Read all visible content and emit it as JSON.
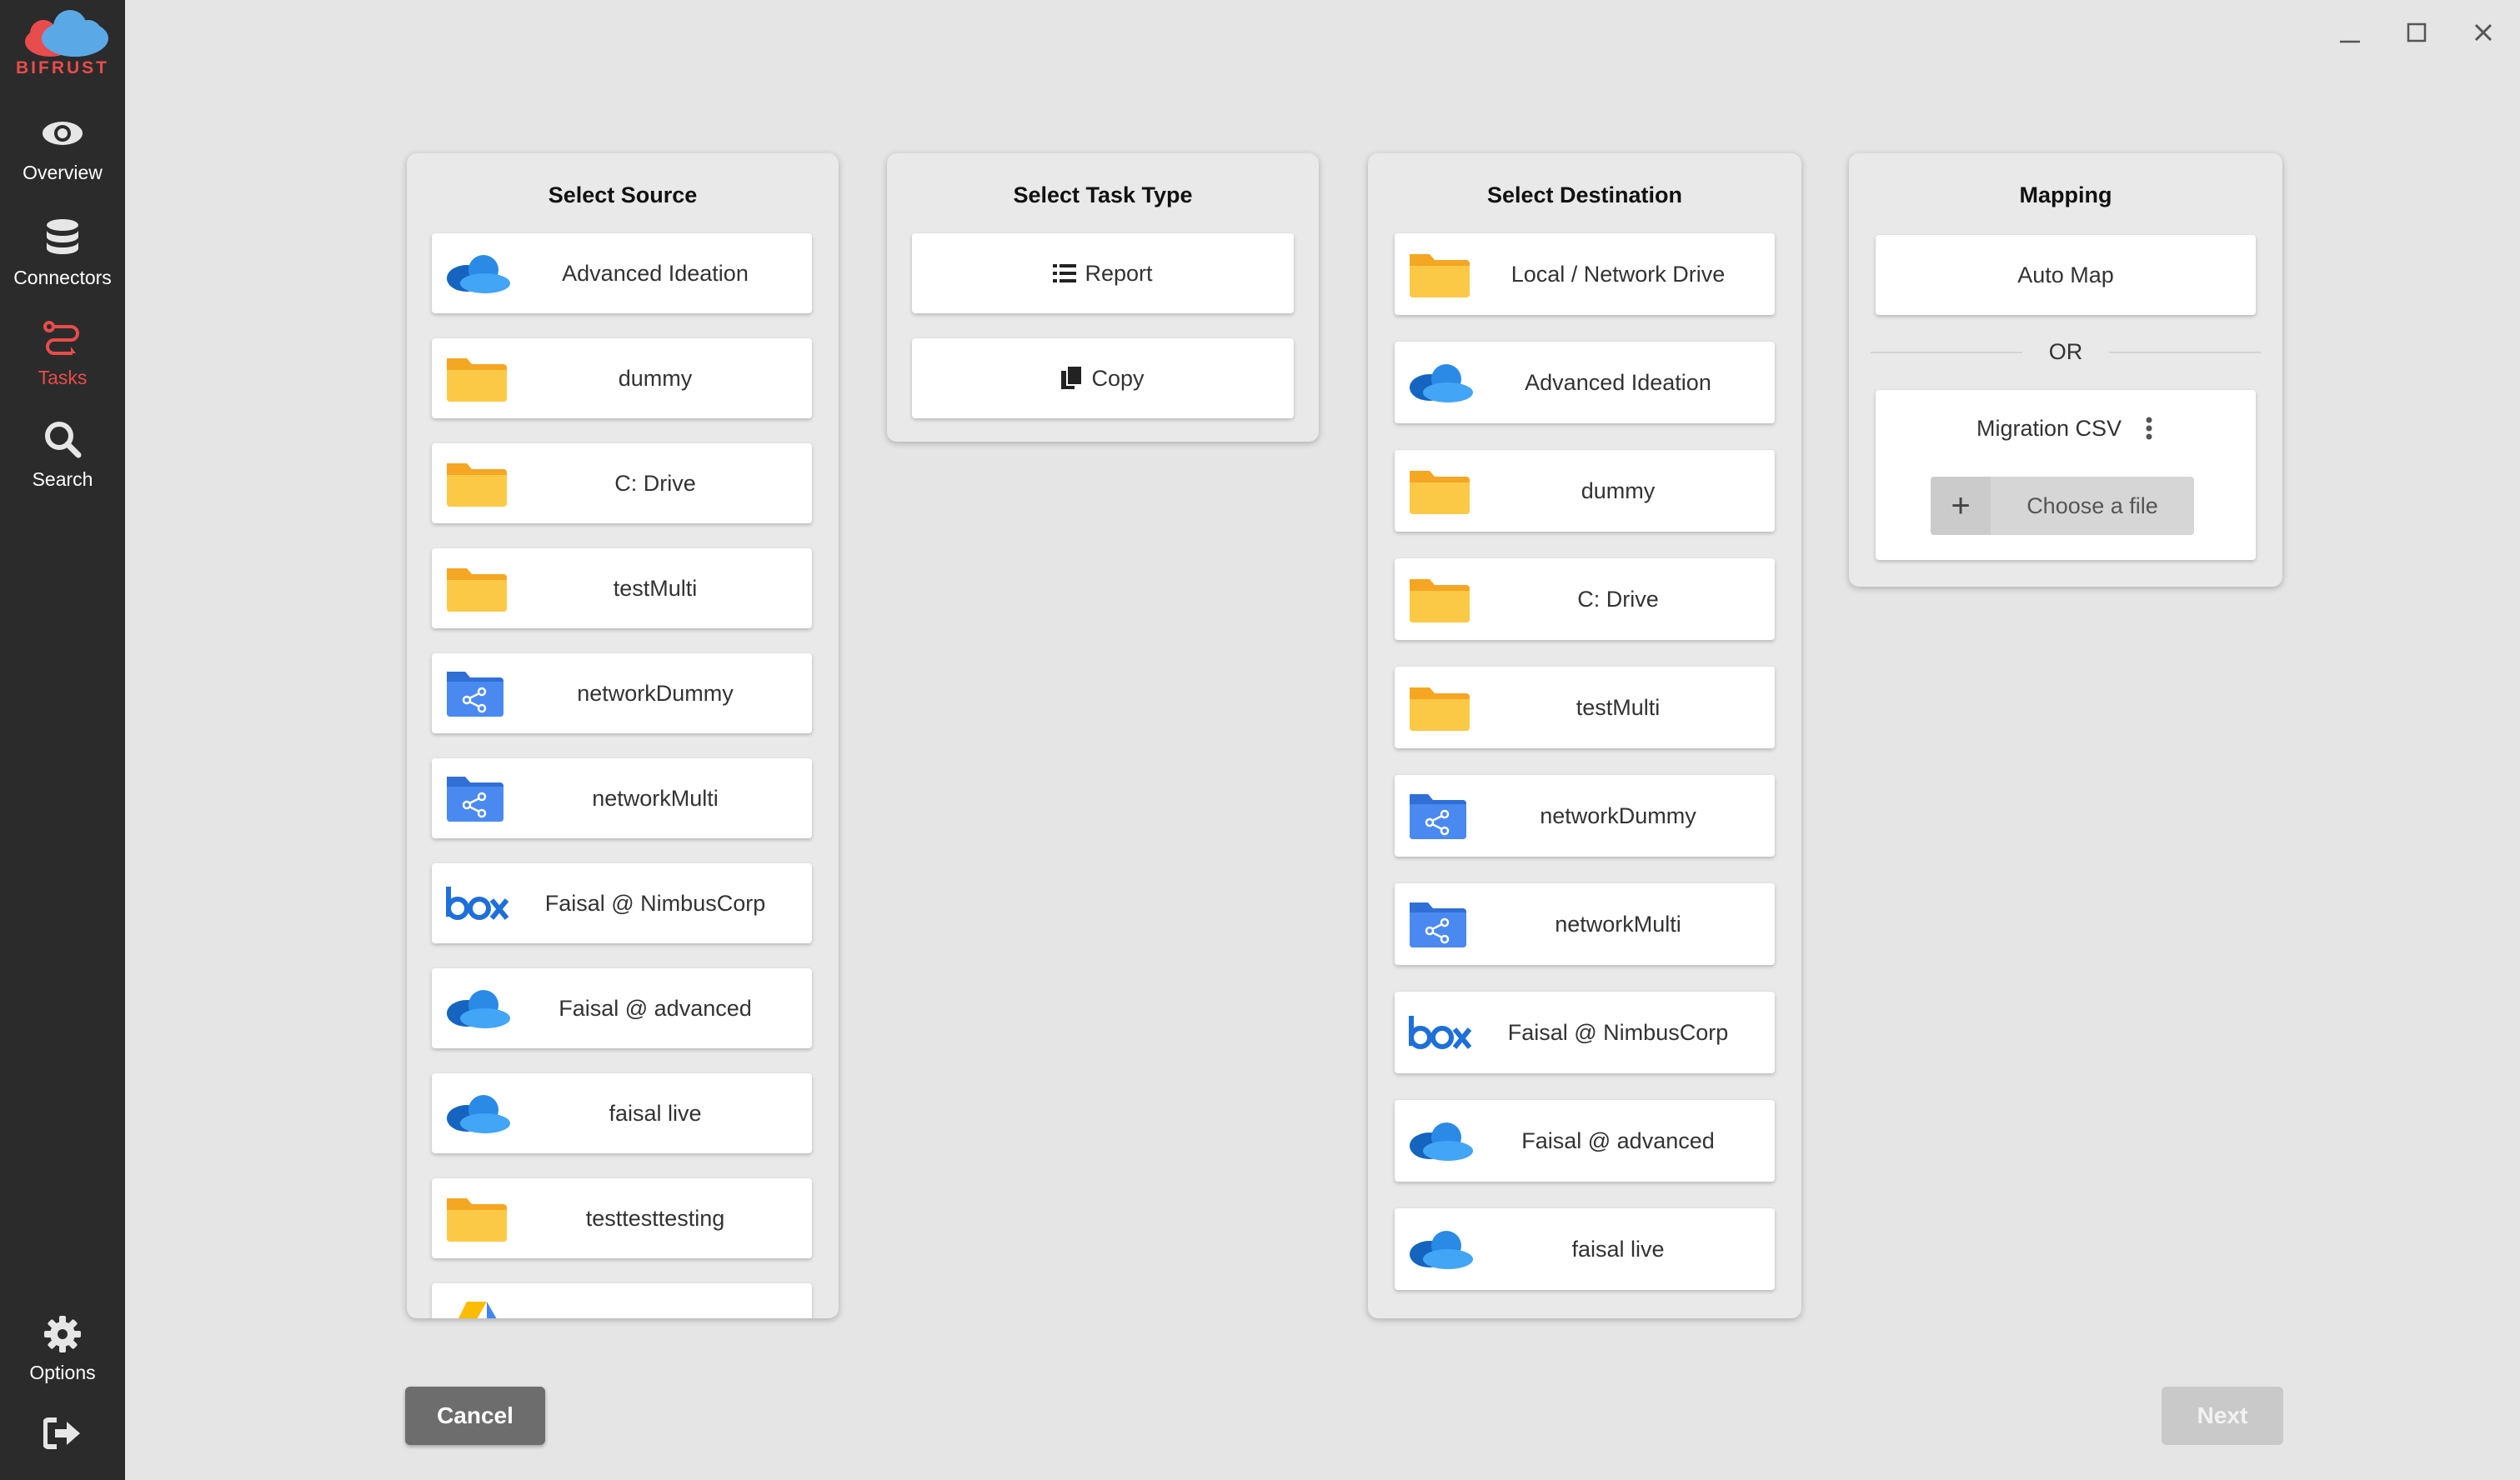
{
  "app": {
    "logo_text": "BIFRUST"
  },
  "sidebar": {
    "items": [
      {
        "label": "Overview",
        "icon": "eye-icon"
      },
      {
        "label": "Connectors",
        "icon": "database-icon"
      },
      {
        "label": "Tasks",
        "icon": "tasks-icon",
        "active": true
      },
      {
        "label": "Search",
        "icon": "search-icon"
      }
    ],
    "options_label": "Options",
    "logout_icon": "logout-icon"
  },
  "source": {
    "title": "Select Source",
    "items": [
      {
        "label": "Advanced Ideation",
        "icon": "onedrive-icon"
      },
      {
        "label": "dummy",
        "icon": "folder-icon"
      },
      {
        "label": "C: Drive",
        "icon": "folder-icon"
      },
      {
        "label": "testMulti",
        "icon": "folder-icon"
      },
      {
        "label": "networkDummy",
        "icon": "network-folder-icon"
      },
      {
        "label": "networkMulti",
        "icon": "network-folder-icon"
      },
      {
        "label": "Faisal @ NimbusCorp",
        "icon": "box-icon"
      },
      {
        "label": "Faisal @ advanced",
        "icon": "onedrive-icon"
      },
      {
        "label": "faisal live",
        "icon": "onedrive-icon"
      },
      {
        "label": "testtesttesting",
        "icon": "folder-icon"
      },
      {
        "label": "",
        "icon": "google-drive-icon"
      }
    ]
  },
  "task_type": {
    "title": "Select Task Type",
    "items": [
      {
        "label": "Report",
        "icon": "list-icon"
      },
      {
        "label": "Copy",
        "icon": "copy-icon"
      }
    ]
  },
  "destination": {
    "title": "Select Destination",
    "items": [
      {
        "label": "Local / Network Drive",
        "icon": "folder-icon"
      },
      {
        "label": "Advanced Ideation",
        "icon": "onedrive-icon"
      },
      {
        "label": "dummy",
        "icon": "folder-icon"
      },
      {
        "label": "C: Drive",
        "icon": "folder-icon"
      },
      {
        "label": "testMulti",
        "icon": "folder-icon"
      },
      {
        "label": "networkDummy",
        "icon": "network-folder-icon"
      },
      {
        "label": "networkMulti",
        "icon": "network-folder-icon"
      },
      {
        "label": "Faisal @ NimbusCorp",
        "icon": "box-icon"
      },
      {
        "label": "Faisal @ advanced",
        "icon": "onedrive-icon"
      },
      {
        "label": "faisal live",
        "icon": "onedrive-icon"
      }
    ]
  },
  "mapping": {
    "title": "Mapping",
    "auto_map_label": "Auto Map",
    "or_label": "OR",
    "csv_label": "Migration CSV",
    "choose_file_label": "Choose a file",
    "plus_label": "+"
  },
  "footer": {
    "cancel_label": "Cancel",
    "next_label": "Next"
  },
  "colors": {
    "accent": "#e84c4c",
    "sidebar_bg": "#2b2b2b",
    "folder": "#fbbd3d",
    "onedrive": "#2f7fd6",
    "network_folder": "#3f7ee8",
    "box_blue": "#1e6fd9"
  }
}
